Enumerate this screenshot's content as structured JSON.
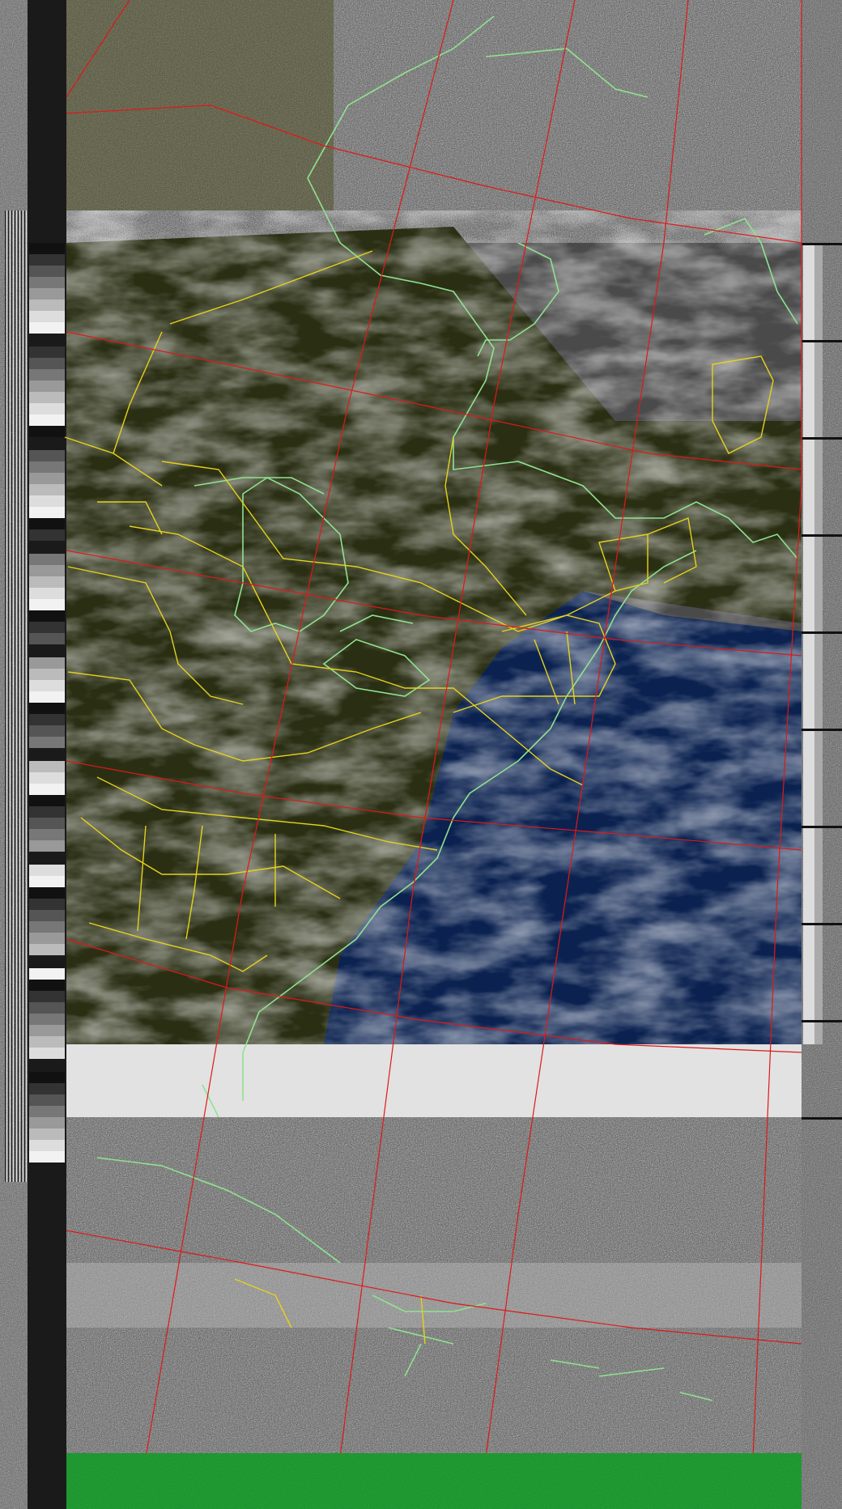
{
  "image": {
    "kind": "NOAA APT weather satellite image with map overlay",
    "colors": {
      "ocean": "#0b2250",
      "land_dark": "#2a2f14",
      "cloud": "#c9c9c9",
      "noise_gray": "#6a6a6a",
      "coastline": "#8fe38f",
      "state_border": "#e6d21a",
      "graticule": "#e01818",
      "sync_green": "#0f5a16"
    },
    "regions": [
      "telemetry-strip-left",
      "telemetry-strip-right",
      "satellite-imagery",
      "noise-band",
      "sync-bar"
    ]
  }
}
